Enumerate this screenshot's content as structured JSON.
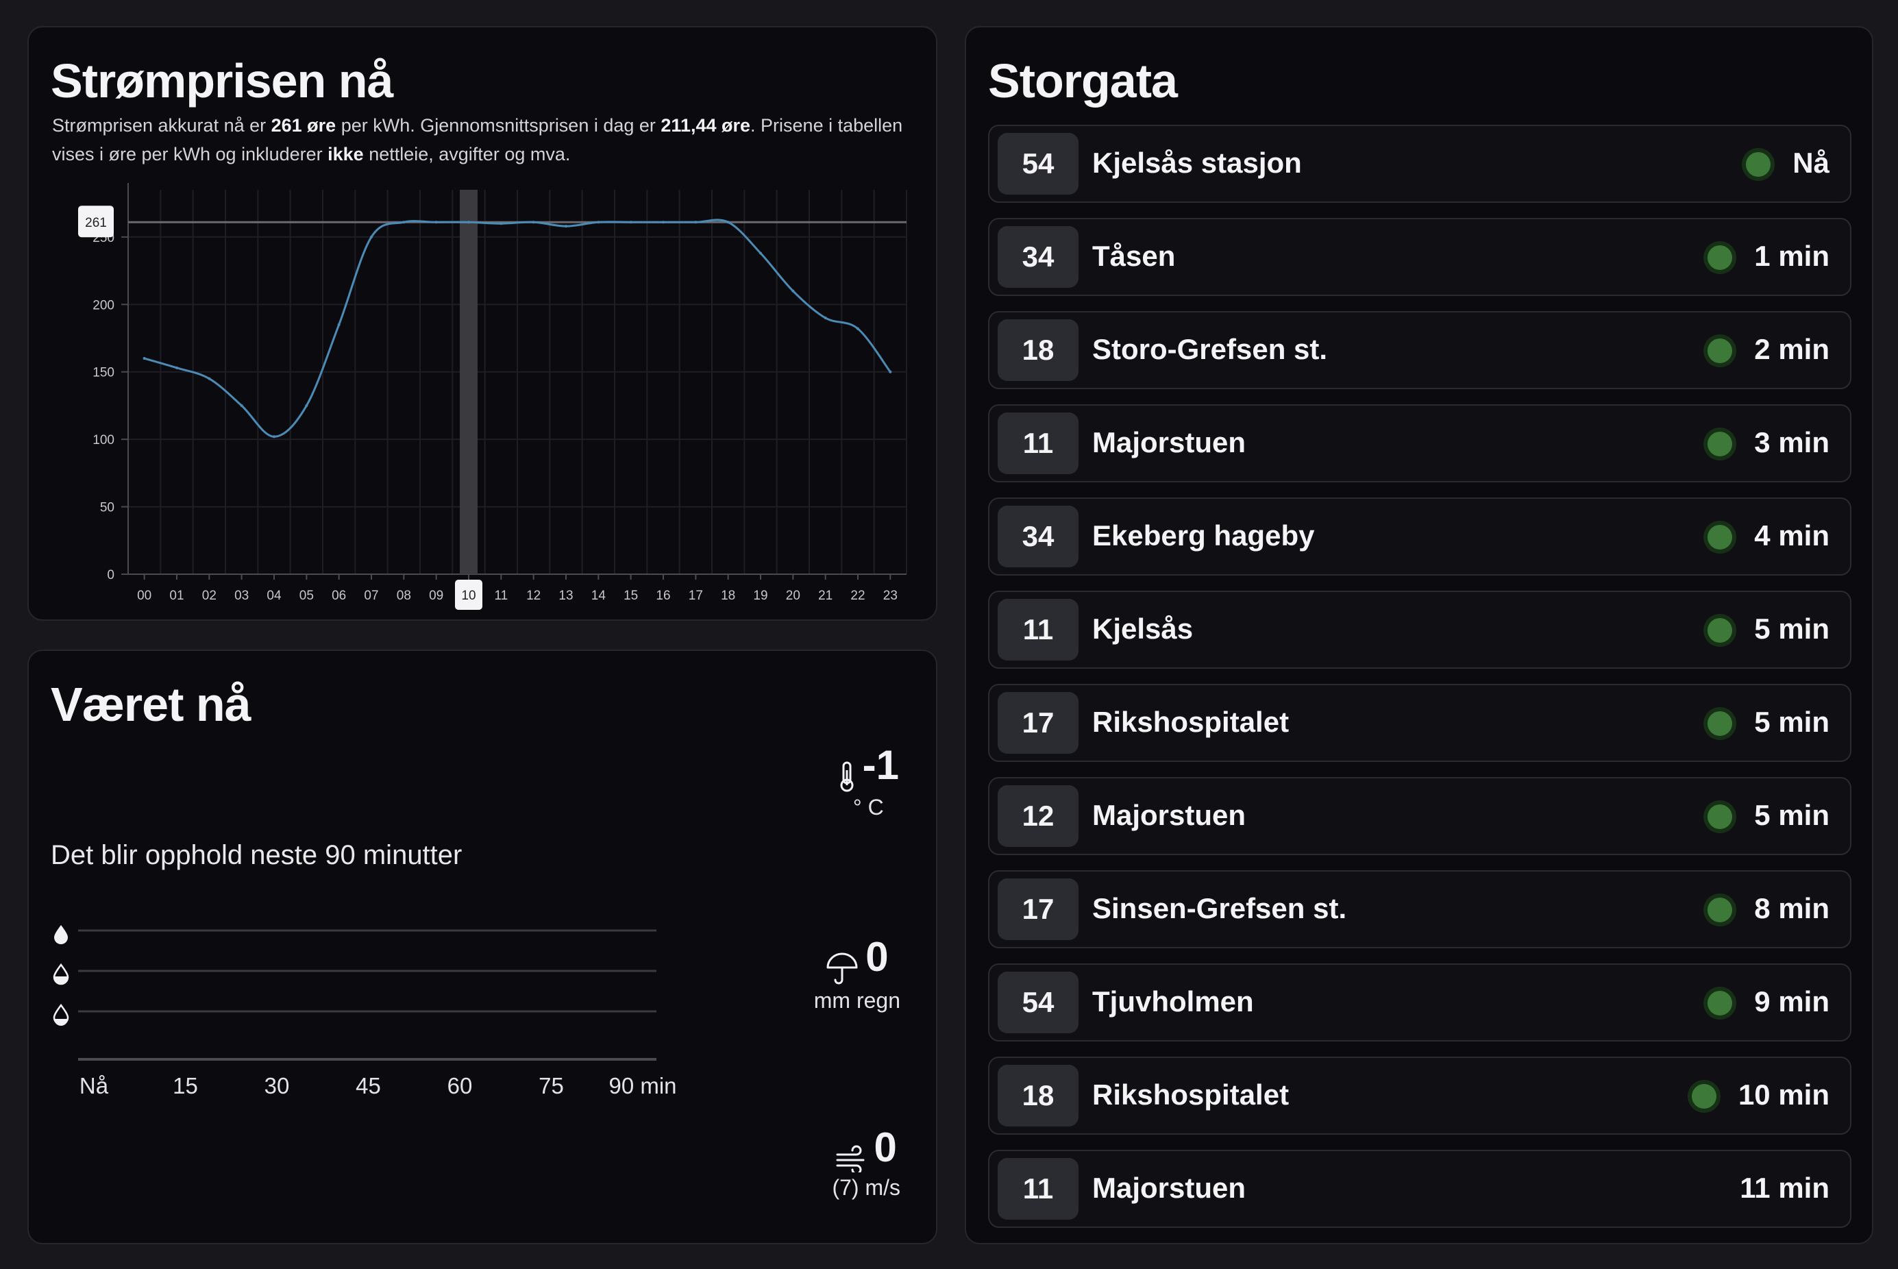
{
  "power": {
    "title": "Strømprisen nå",
    "desc": {
      "p1": "Strømprisen akkurat nå er ",
      "price_now": "261 øre",
      "p2": " per kWh. Gjennomsnittsprisen i dag er ",
      "avg": "211,44 øre",
      "p3": ". Prisene i tabellen vises i øre per kWh og inkluderer ",
      "emph": "ikke",
      "p4": " nettleie, avgifter og mva."
    }
  },
  "chart_data": {
    "type": "line",
    "x": [
      "00",
      "01",
      "02",
      "03",
      "04",
      "05",
      "06",
      "07",
      "08",
      "09",
      "10",
      "11",
      "12",
      "13",
      "14",
      "15",
      "16",
      "17",
      "18",
      "19",
      "20",
      "21",
      "22",
      "23"
    ],
    "series": [
      {
        "values": [
          160,
          153,
          145,
          125,
          102,
          125,
          185,
          250,
          261,
          261,
          261,
          260,
          261,
          258,
          261,
          261,
          261,
          261,
          261,
          238,
          210,
          190,
          182,
          150
        ]
      }
    ],
    "y_ticks": [
      "0",
      "50",
      "100",
      "150",
      "200",
      "250"
    ],
    "ylim": [
      0,
      285
    ],
    "current_hour": "10",
    "current_price_label": "261",
    "reference_line": 261,
    "grid": true,
    "line_color": "#4c8bb5"
  },
  "weather": {
    "title": "Været nå",
    "rain_text": "Det blir opphold neste 90 minutter",
    "temperature": {
      "value": "-1",
      "unit": "° C",
      "icon": "thermometer-icon"
    },
    "rain": {
      "value": "0",
      "unit": "mm regn",
      "icon": "umbrella-icon"
    },
    "wind": {
      "value": "0",
      "unit": "(7) m/s",
      "icon": "wind-icon"
    },
    "precip_axis": [
      "Nå",
      "15",
      "30",
      "45",
      "60",
      "75",
      "90 min"
    ],
    "precip_levels": [
      "heavy-drop-icon",
      "medium-drop-icon",
      "light-drop-icon"
    ]
  },
  "departures": {
    "title": "Storgata",
    "rows": [
      {
        "line": "54",
        "dest": "Kjelsås stasjon",
        "time": "Nå",
        "live": true
      },
      {
        "line": "34",
        "dest": "Tåsen",
        "time": "1 min",
        "live": true
      },
      {
        "line": "18",
        "dest": "Storo-Grefsen st.",
        "time": "2 min",
        "live": true
      },
      {
        "line": "11",
        "dest": "Majorstuen",
        "time": "3 min",
        "live": true
      },
      {
        "line": "34",
        "dest": "Ekeberg hageby",
        "time": "4 min",
        "live": true
      },
      {
        "line": "11",
        "dest": "Kjelsås",
        "time": "5 min",
        "live": true
      },
      {
        "line": "17",
        "dest": "Rikshospitalet",
        "time": "5 min",
        "live": true
      },
      {
        "line": "12",
        "dest": "Majorstuen",
        "time": "5 min",
        "live": true
      },
      {
        "line": "17",
        "dest": "Sinsen-Grefsen st.",
        "time": "8 min",
        "live": true
      },
      {
        "line": "54",
        "dest": "Tjuvholmen",
        "time": "9 min",
        "live": true
      },
      {
        "line": "18",
        "dest": "Rikshospitalet",
        "time": "10 min",
        "live": true
      },
      {
        "line": "11",
        "dest": "Majorstuen",
        "time": "11 min",
        "live": false
      }
    ],
    "live_color": "#3d7a3a"
  }
}
